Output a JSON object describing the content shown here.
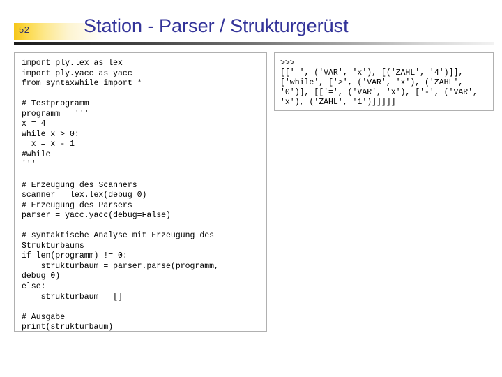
{
  "slide": {
    "number": "52",
    "title": "Station - Parser / Strukturgerüst",
    "accent_color": "#333399",
    "badge_color": "#f5c518",
    "rule_color": "#1a1a1a"
  },
  "code_panel": {
    "language": "python",
    "lines": [
      "import ply.lex as lex",
      "import ply.yacc as yacc",
      "from syntaxWhile import *",
      "",
      "# Testprogramm",
      "programm = '''",
      "x = 4",
      "while x > 0:",
      "  x = x - 1",
      "#while",
      "'''",
      "",
      "# Erzeugung des Scanners",
      "scanner = lex.lex(debug=0)",
      "# Erzeugung des Parsers",
      "parser = yacc.yacc(debug=False)",
      "",
      "# syntaktische Analyse mit Erzeugung des",
      "Strukturbaums",
      "if len(programm) != 0:",
      "    strukturbaum = parser.parse(programm,",
      "debug=0)",
      "else:",
      "    strukturbaum = []",
      "",
      "# Ausgabe",
      "print(strukturbaum)"
    ]
  },
  "output_panel": {
    "prompt": ">>>",
    "lines": [
      ">>>",
      "[['=', ('VAR', 'x'), [('ZAHL', '4')]],",
      "['while', ['>', ('VAR', 'x'), ('ZAHL',",
      "'0')], [['=', ('VAR', 'x'), ['-', ('VAR',",
      "'x'), ('ZAHL', '1')]]]]]"
    ]
  }
}
